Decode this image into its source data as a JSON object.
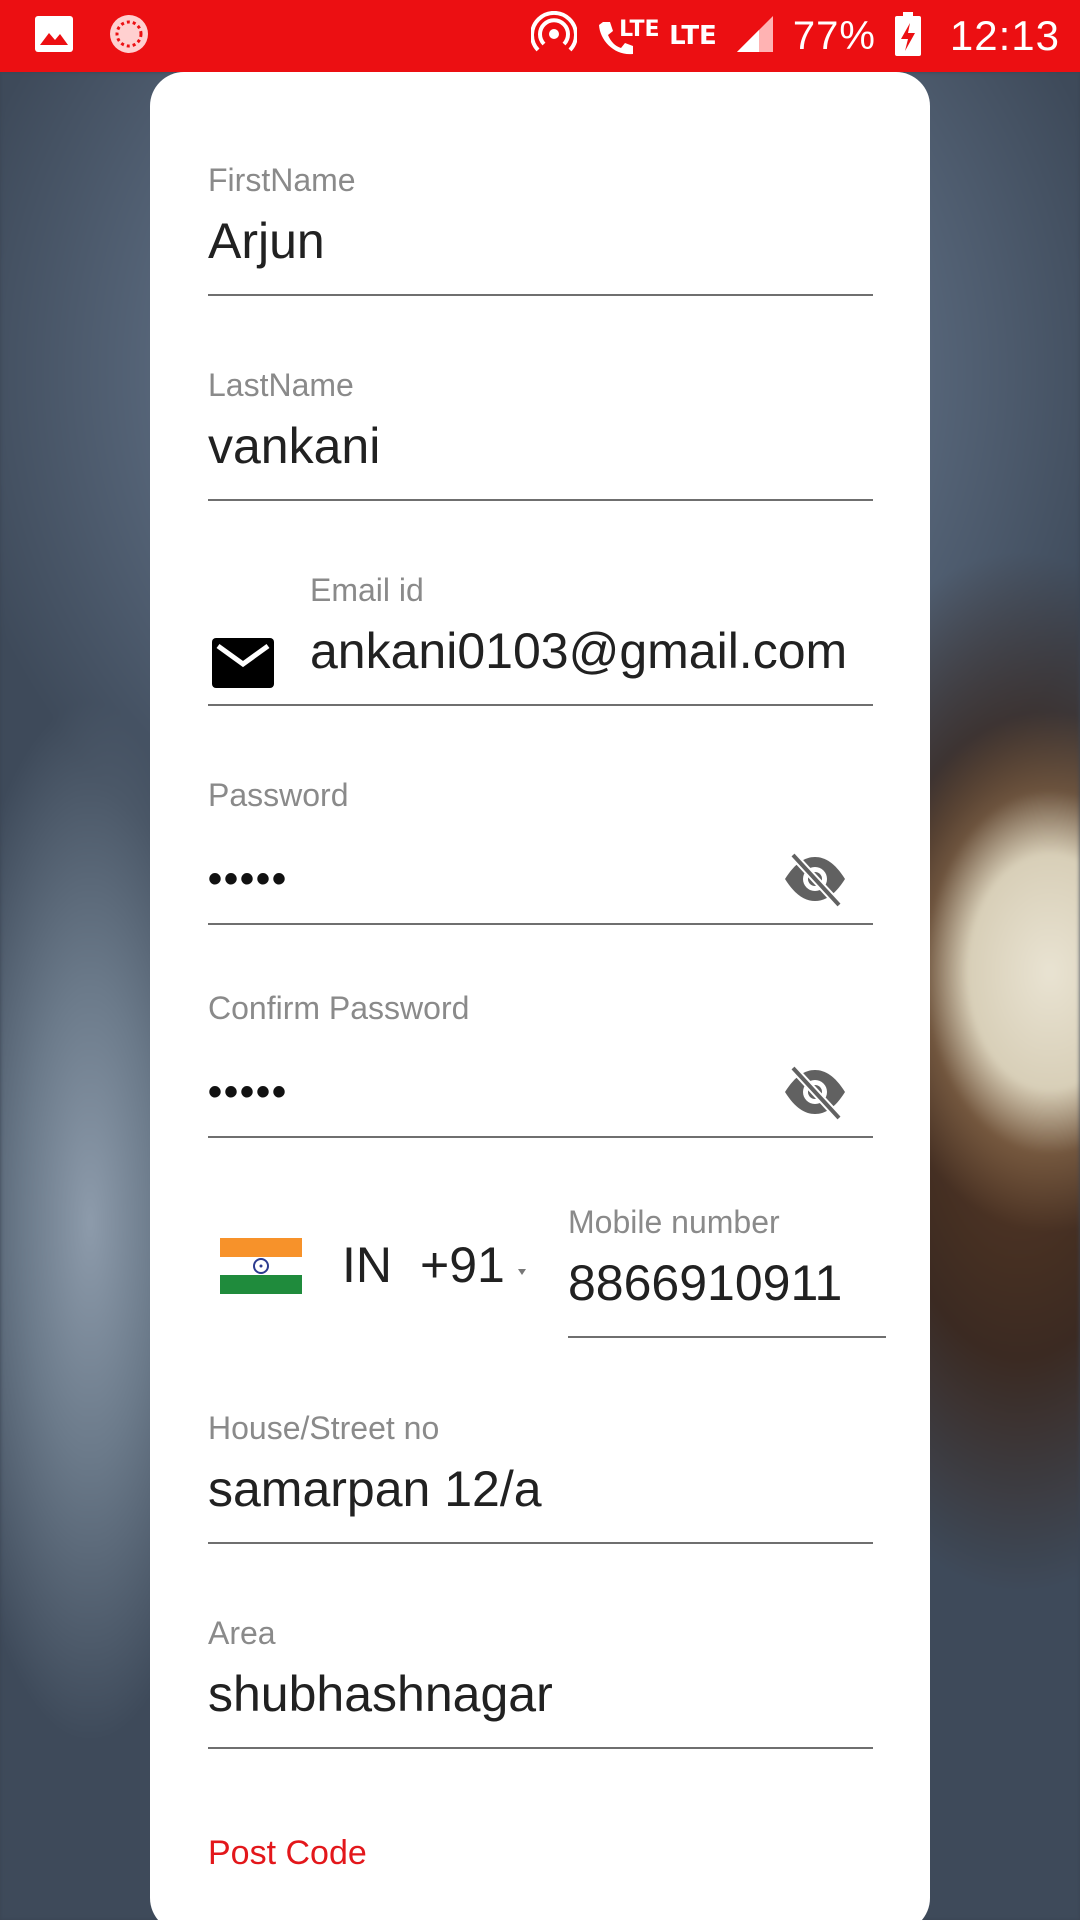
{
  "status_bar": {
    "battery": "77%",
    "time": "12:13",
    "network_1": "LTE",
    "network_2": "LTE",
    "icons": [
      "gallery-icon",
      "loading-icon",
      "hotspot-icon",
      "wifi-call-icon",
      "signal-icon",
      "battery-charging-icon"
    ]
  },
  "form": {
    "first_name": {
      "label": "FirstName",
      "value": "Arjun"
    },
    "last_name": {
      "label": "LastName",
      "value": "vankani"
    },
    "email": {
      "label": "Email id",
      "value": "ankani0103@gmail.com",
      "icon": "email-icon"
    },
    "password": {
      "label": "Password",
      "value": "•••••",
      "icon": "eye-off-icon"
    },
    "confirm_password": {
      "label": "Confirm Password",
      "value": "•••••",
      "icon": "eye-off-icon"
    },
    "country": {
      "code": "IN",
      "dial_code": "+91",
      "flag": "india-flag-icon"
    },
    "mobile": {
      "label": "Mobile number",
      "value": "8866910911"
    },
    "house": {
      "label": "House/Street no",
      "value": "samarpan 12/a"
    },
    "area": {
      "label": "Area",
      "value": "shubhashnagar"
    },
    "post_code": {
      "label": "Post Code"
    }
  },
  "colors": {
    "status_bar": "#ec0f12",
    "accent": "#e3171b",
    "label": "#8a8a8a",
    "text": "#212121"
  }
}
